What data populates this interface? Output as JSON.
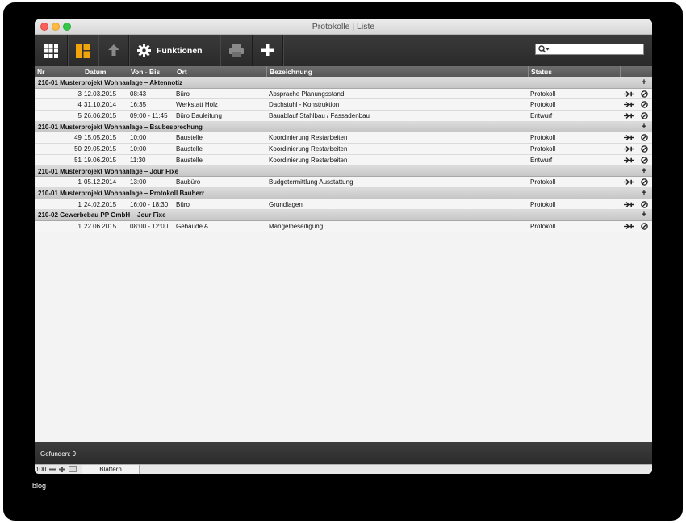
{
  "window": {
    "title": "Protokolle | Liste"
  },
  "toolbar": {
    "buttons": [
      {
        "icon": "grid-icon",
        "label": ""
      },
      {
        "icon": "layout-icon",
        "label": ""
      },
      {
        "icon": "arrow-up-icon",
        "label": ""
      },
      {
        "icon": "gear-icon",
        "label": "Funktionen"
      },
      {
        "icon": "printer-icon",
        "label": ""
      },
      {
        "icon": "plus-icon",
        "label": ""
      }
    ],
    "search": {
      "value": "",
      "placeholder": ""
    }
  },
  "columns": {
    "nr": "Nr",
    "datum": "Datum",
    "von_bis": "Von - Bis",
    "ort": "Ort",
    "bezeichnung": "Bezeichnung",
    "status": "Status"
  },
  "groups": [
    {
      "label": "210-01  Musterprojekt Wohnanlage  –  Aktennotiz",
      "rows": [
        {
          "nr": "3",
          "datum": "12.03.2015",
          "zeit": "08:43",
          "ort": "Büro",
          "bezeichnung": "Absprache Planungsstand",
          "status": "Protokoll"
        },
        {
          "nr": "4",
          "datum": "31.10.2014",
          "zeit": "16:35",
          "ort": "Werkstatt Holz",
          "bezeichnung": "Dachstuhl - Konstruktion",
          "status": "Protokoll"
        },
        {
          "nr": "5",
          "datum": "26.06.2015",
          "zeit": "09:00 - 11:45",
          "ort": "Büro Bauleitung",
          "bezeichnung": "Bauablauf Stahlbau / Fassadenbau",
          "status": "Entwurf"
        }
      ]
    },
    {
      "label": "210-01  Musterprojekt Wohnanlage  –  Baubesprechung",
      "rows": [
        {
          "nr": "49",
          "datum": "15.05.2015",
          "zeit": "10:00",
          "ort": "Baustelle",
          "bezeichnung": "Koordinierung Restarbeiten",
          "status": "Protokoll"
        },
        {
          "nr": "50",
          "datum": "29.05.2015",
          "zeit": "10:00",
          "ort": "Baustelle",
          "bezeichnung": "Koordinierung Restarbeiten",
          "status": "Protokoll"
        },
        {
          "nr": "51",
          "datum": "19.06.2015",
          "zeit": "11:30",
          "ort": "Baustelle",
          "bezeichnung": "Koordinierung Restarbeiten",
          "status": "Entwurf"
        }
      ]
    },
    {
      "label": "210-01  Musterprojekt Wohnanlage  –  Jour Fixe",
      "rows": [
        {
          "nr": "1",
          "datum": "05.12.2014",
          "zeit": "13:00",
          "ort": "Baubüro",
          "bezeichnung": "Budgetermittlung Ausstattung",
          "status": "Protokoll"
        }
      ]
    },
    {
      "label": "210-01  Musterprojekt Wohnanlage  –  Protokoll Bauherr",
      "rows": [
        {
          "nr": "1",
          "datum": "24.02.2015",
          "zeit": "16:00 - 18:30",
          "ort": "Büro",
          "bezeichnung": "Grundlagen",
          "status": "Protokoll"
        }
      ]
    },
    {
      "label": "210-02  Gewerbebau PP GmbH  –  Jour Fixe",
      "rows": [
        {
          "nr": "1",
          "datum": "22.06.2015",
          "zeit": "08:00 - 12:00",
          "ort": "Gebäude A",
          "bezeichnung": "Mängelbeseitigung",
          "status": "Protokoll"
        }
      ]
    }
  ],
  "status_bar": {
    "found": "Gefunden: 9"
  },
  "bottom_bar": {
    "zoom": "100",
    "mode": "Blättern"
  },
  "caption": "blog",
  "colors": {
    "accent_layout": "#f0a30a",
    "toolbar_bg": "#2f2f2f",
    "header_bg": "#5e5e5e"
  }
}
